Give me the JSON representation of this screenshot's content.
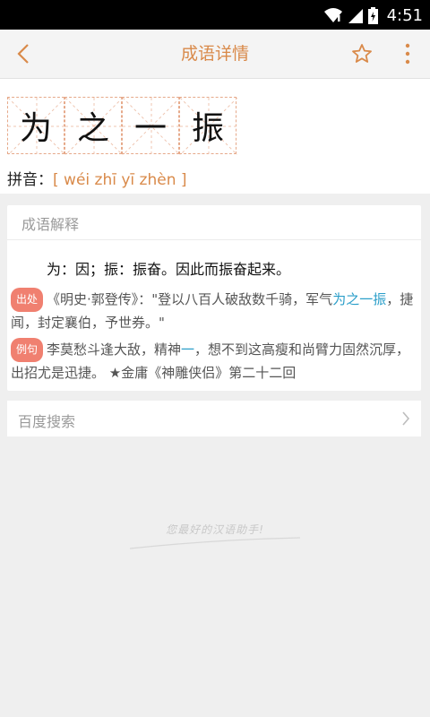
{
  "status": {
    "time": "4:51"
  },
  "app_bar": {
    "title": "成语详情"
  },
  "idiom": {
    "chars": [
      "为",
      "之",
      "一",
      "振"
    ],
    "pinyin_label": "拼音：",
    "pinyin": "[ wéi zhī yī zhèn ]"
  },
  "detail": {
    "section_title": "成语解释",
    "meaning": "为：因；振：振奋。因此而振奋起来。",
    "source": {
      "tag": "出处",
      "text_before": "《明史·郭登传》：\"登以八百人破敌数千骑，军气",
      "highlight": "为之一振",
      "text_after": "，捷闻，封定襄伯，予世券。\""
    },
    "example": {
      "tag": "例句",
      "text_before": "李莫愁斗逢大敌，精神",
      "highlight": "一",
      "text_after": "，想不到这高瘦和尚臂力固然沉厚，出招尤是迅捷。 ★金庸《神雕侠侣》第二十二回"
    }
  },
  "search": {
    "label": "百度搜索"
  },
  "watermark": "您最好的汉语助手!",
  "colors": {
    "accent": "#d98a4a",
    "tag_bg": "#f08070",
    "link": "#2a9ec9"
  }
}
